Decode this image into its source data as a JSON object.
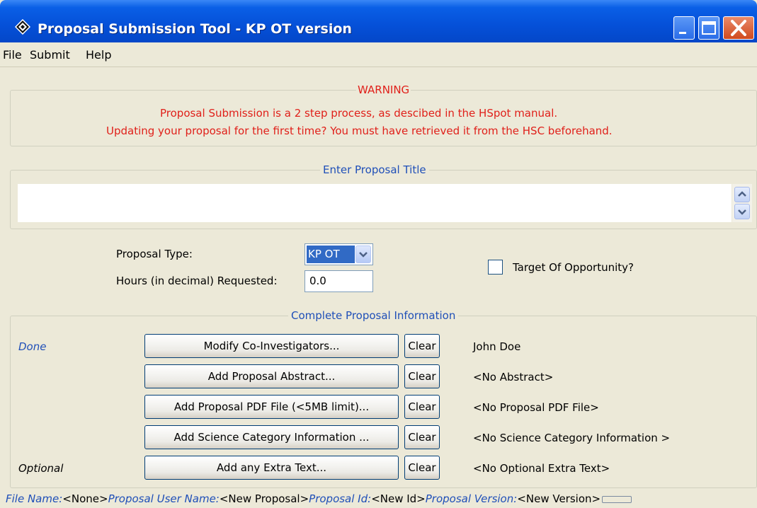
{
  "window": {
    "title": "Proposal Submission Tool - KP OT version",
    "icon": "diamond-app-icon",
    "controls": [
      "minimize-icon",
      "maximize-icon",
      "close-icon"
    ]
  },
  "menu": [
    "File",
    "Submit",
    "Help"
  ],
  "warning": {
    "heading": "WARNING",
    "line1": "Proposal Submission is a 2 step process, as descibed in the HSpot manual.",
    "line2": "Updating your proposal for the first time? You must have retrieved it from the HSC beforehand."
  },
  "title_section": {
    "legend": "Enter Proposal Title",
    "value": ""
  },
  "proposal_type": {
    "label": "Proposal Type:",
    "value": "KP OT"
  },
  "hours": {
    "label": "Hours (in decimal) Requested:",
    "value": "0.0"
  },
  "target_of_opportunity": {
    "label": "Target Of Opportunity?",
    "checked": false
  },
  "info_section": {
    "legend": "Complete Proposal Information",
    "rows": [
      {
        "status": "Done",
        "button": "Modify Co-Investigators...",
        "clear": "Clear",
        "value": "John Doe"
      },
      {
        "status": "",
        "button": "Add Proposal Abstract...",
        "clear": "Clear",
        "value": "<No Abstract>"
      },
      {
        "status": "",
        "button": "Add Proposal PDF File (<5MB limit)...",
        "clear": "Clear",
        "value": "<No Proposal PDF File>"
      },
      {
        "status": "",
        "button": "Add Science Category Information ...",
        "clear": "Clear",
        "value": "<No Science Category Information >"
      },
      {
        "status": "Optional",
        "button": "Add any Extra Text...",
        "clear": "Clear",
        "value": "<No Optional Extra Text>"
      }
    ]
  },
  "status_bar": {
    "file_name_label": "File Name:",
    "file_name": "<None>",
    "user_name_label": "Proposal User Name:",
    "user_name": "<New Proposal>",
    "id_label": "Proposal Id:",
    "id": "<New Id>",
    "version_label": "Proposal Version:",
    "version": "<New Version>"
  },
  "colors": {
    "title_bar": "#0550d8",
    "warning_text": "#e0201a",
    "accent_text": "#1f4fb8",
    "panel_bg": "#ece9d8"
  }
}
